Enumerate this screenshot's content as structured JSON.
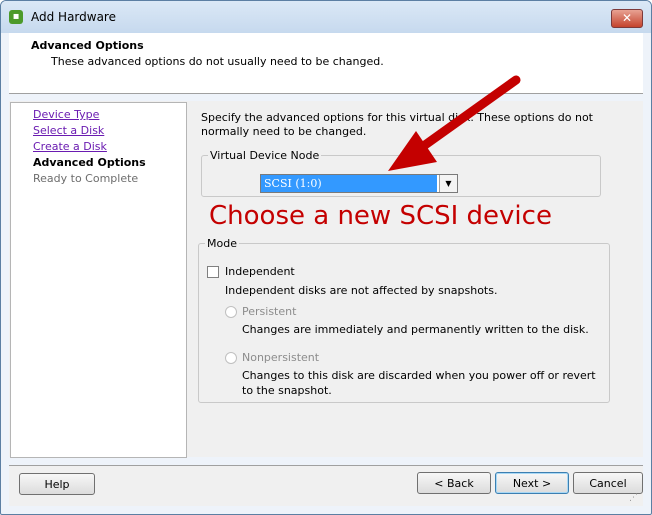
{
  "window": {
    "title": "Add Hardware",
    "close_label": "✕"
  },
  "header": {
    "title": "Advanced Options",
    "subtitle": "These advanced options do not usually need to be changed."
  },
  "sidebar": {
    "items": [
      {
        "label": "Device Type",
        "state": "link"
      },
      {
        "label": "Select a Disk",
        "state": "link"
      },
      {
        "label": "Create a Disk",
        "state": "link"
      },
      {
        "label": "Advanced Options",
        "state": "current"
      },
      {
        "label": "Ready to Complete",
        "state": "disabled"
      }
    ]
  },
  "main": {
    "description": "Specify the advanced options for this virtual disk. These options do not normally need to be changed.",
    "vdn": {
      "legend": "Virtual Device Node",
      "selected": "SCSI (1:0)"
    },
    "annotation": "Choose a new SCSI device",
    "mode": {
      "legend": "Mode",
      "independent_label": "Independent",
      "independent_checked": false,
      "independent_note": "Independent disks are not affected by snapshots.",
      "persistent_label": "Persistent",
      "persistent_note": "Changes are immediately and permanently written to the disk.",
      "nonpersistent_label": "Nonpersistent",
      "nonpersistent_note": "Changes to this disk are discarded when you power off or revert to the snapshot."
    }
  },
  "footer": {
    "help": "Help",
    "back": "< Back",
    "next": "Next >",
    "cancel": "Cancel"
  },
  "colors": {
    "annotation": "#c40000",
    "link": "#6a1bb1",
    "selection": "#3399ff"
  }
}
